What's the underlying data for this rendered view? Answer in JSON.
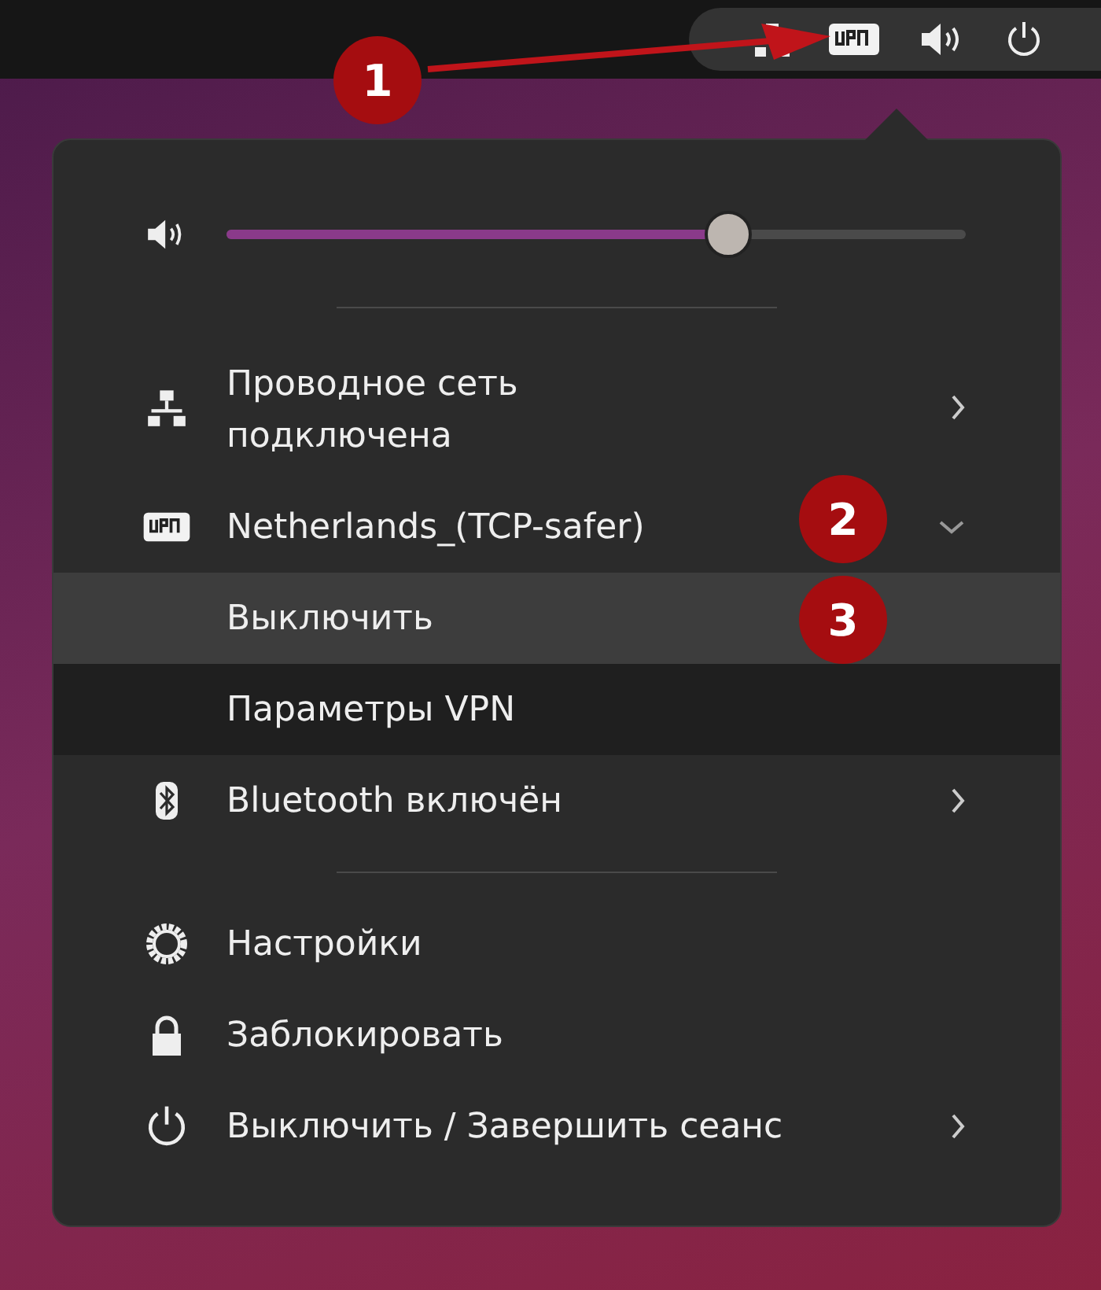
{
  "volume": {
    "level": 0.69
  },
  "network": {
    "label": "Проводное сеть подключена",
    "submenu": true
  },
  "vpn": {
    "label": "Netherlands_(TCP-safer)",
    "expanded": true,
    "items": [
      {
        "label": "Выключить",
        "selected": true
      },
      {
        "label": "Параметры VPN",
        "selected": false
      }
    ]
  },
  "bluetooth": {
    "label": "Bluetooth включён",
    "submenu": true
  },
  "actions": [
    {
      "label": "Настройки",
      "submenu": false
    },
    {
      "label": "Заблокировать",
      "submenu": false
    },
    {
      "label": "Выключить / Завершить сеанс",
      "submenu": true
    }
  ],
  "annotations": [
    {
      "label": "1"
    },
    {
      "label": "2"
    },
    {
      "label": "3"
    }
  ]
}
